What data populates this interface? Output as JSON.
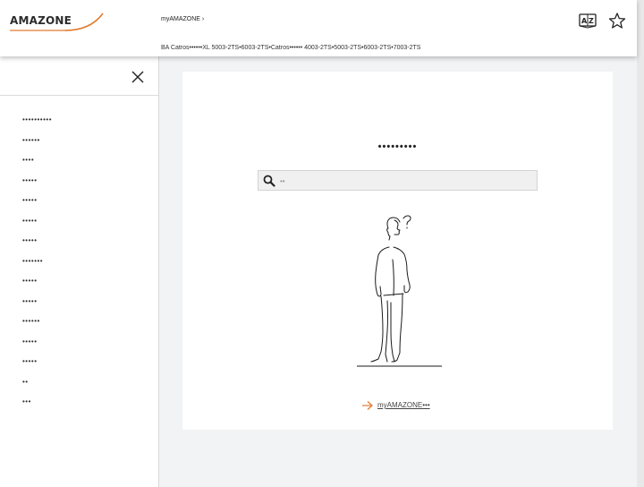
{
  "header": {
    "logo_text": "AMAZONE",
    "breadcrumb": "myAMAZONE ›",
    "doc_title": "BA Catros••••••XL 5003-2TS•6003-2TS•Catros•••••• 4003-2TS•5003-2TS•6003-2TS•7003-2TS",
    "icons": [
      "dictionary-icon",
      "star-icon"
    ]
  },
  "sidebar": {
    "close_icon": "close-icon",
    "items": [
      {
        "label": "••••••••••"
      },
      {
        "label": "••••••"
      },
      {
        "label": "••••"
      },
      {
        "label": "•••••"
      },
      {
        "label": "•••••"
      },
      {
        "label": "•••••"
      },
      {
        "label": "•••••"
      },
      {
        "label": "•••••••"
      },
      {
        "label": "•••••"
      },
      {
        "label": "•••••"
      },
      {
        "label": "••••••"
      },
      {
        "label": "•••••"
      },
      {
        "label": "•••••"
      },
      {
        "label": "••"
      },
      {
        "label": "•••"
      }
    ]
  },
  "main": {
    "title": "•••••••••",
    "search": {
      "placeholder": "••",
      "value": ""
    },
    "link_label": "myAMAZONE•••"
  },
  "colors": {
    "accent": "#e07a2e",
    "page_bg": "#f2f3f4"
  }
}
